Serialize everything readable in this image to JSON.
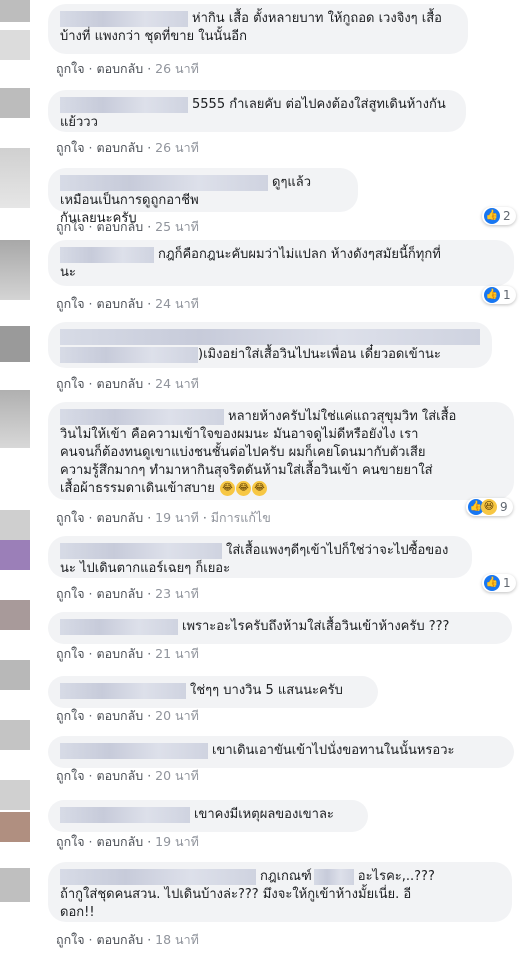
{
  "actions": {
    "like": "ถูกใจ",
    "reply": "ตอบกลับ",
    "edited": "มีการแก้ไข"
  },
  "comments": [
    {
      "text_line1": "ห่ากิน เสื้อ ตั้งหลายบาท ให้กูถอด เวงจิงๆ เสื้อ",
      "text_line2": "บ้างที่ แพงกว่า ชุดที่ขาย ในนั้นอีก",
      "time": "26 นาที"
    },
    {
      "text_line1": "5555 กำเลยคับ ต่อไปคงต้องใส่สูทเดินห้างกัน",
      "text_line2": "แย้ววว",
      "time": "26 นาที"
    },
    {
      "text_line1": "ดูๆแล้วเหมือนเป็นการดูถูกอาชีพ",
      "text_line2": "กันเลยนะครับ",
      "time": "25 นาที",
      "reactions": "2"
    },
    {
      "text_line1": "กฎก็คือกฎนะคับผมว่าไม่แปลก ห้างดังๆสมัยนี้ก็ทุกที่",
      "text_line2": "นะ",
      "time": "24 นาที",
      "reactions": "1"
    },
    {
      "text_line1": ")เมิงอย่าใส่เสื้อวินไปนะเพื่อน เดี๋ยวอดเข้านะ",
      "time": "24 นาที"
    },
    {
      "text_line1": "หลายห้างครับไม่ใช่แค่แถวสุขุมวิท ใส่เสื้อ",
      "text_line2": "วินไม่ให้เข้า คือความเข้าใจของผมนะ มันอาจดูไม่ดีหรือยังไง เรา",
      "text_line3": "คนจนก็ต้องทนดูเขาแบ่งชนชั้นต่อไปครับ ผมก็เคยโดนมากับตัวเสีย",
      "text_line4": "ความรู้สึกมากๆ ทำมาหากินสุจริตดันห้ามใส่เสื้อวินเข้า คนขายยาใส่",
      "text_line5": "เสื้อผ้าธรรมดาเดินเข้าสบาย",
      "time": "19 นาที",
      "reactions": "9"
    },
    {
      "text_line1": "ใส่เสื้อแพงๆดีๆเข้าไปก็ใช่ว่าจะไปซื้อของ",
      "text_line2": "นะ ไปเดินตากแอร์เฉยๆ ก็เยอะ",
      "time": "23 นาที",
      "reactions": "1"
    },
    {
      "text_line1": "เพราะอะไรครับถึงห้ามใส่เสื้อวินเข้าห้างครับ ???",
      "time": "21 นาที"
    },
    {
      "text_line1": "ใช่ๆๆ บางวิน 5 แสนนะครับ",
      "time": "20 นาที"
    },
    {
      "text_line1": "เขาเดินเอาขันเข้าไปนั่งขอทานในนั้นหรอวะ",
      "time": "20 นาที"
    },
    {
      "text_line1": "เขาคงมีเหตุผลของเขาละ",
      "time": "19 นาที"
    },
    {
      "text_line1": "กฎเกณฑ์",
      "text_line1b": "อะไรคะ,..???",
      "text_line2": "ถ้ากูใส่ชุดคนสวน. ไปเดินบ้างล่ะ??? มึงจะให้กูเข้าห้างมั้ยเนี่ย. อี",
      "text_line3": "ดอก!!",
      "time": "18 นาที"
    }
  ]
}
